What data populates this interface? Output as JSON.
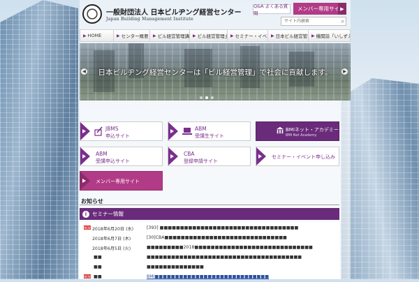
{
  "header": {
    "org_name": "一般財団法人 日本ビルヂング経営センター",
    "org_name_en": "Japan Building Management Institute",
    "qa_label": "Q&A よくある質問",
    "member_site_label": "メンバー専用サイト",
    "search_placeholder": "サイト内検索"
  },
  "nav": {
    "items": [
      {
        "label": "HOME"
      },
      {
        "label": "センター概要"
      },
      {
        "label": "ビル経営管理講座"
      },
      {
        "label": "ビル経営管理士"
      },
      {
        "label": "セミナー・イベント"
      },
      {
        "label": "日本ビル経営管理士会"
      },
      {
        "label": "機関誌「いしずえ」"
      }
    ]
  },
  "hero": {
    "caption": "日本ビルヂング経営センターは「ビル経営管理」で社会に貢献します。"
  },
  "tiles": {
    "jbms": {
      "line1": "JBMS",
      "line2": "申込サイト"
    },
    "abm_student": {
      "line1": "ABM",
      "line2": "受講生サイト"
    },
    "bmi_net": {
      "line1": "BMIネット・アカデミー",
      "line2": "BMI Net Academy"
    },
    "abm_apply": {
      "line1": "ABM",
      "line2": "受講申込サイト"
    },
    "cba": {
      "line1": "CBA",
      "line2": "登録申請サイト"
    },
    "seminar_apply": {
      "label": "セミナー・イベント申し込み"
    },
    "member": {
      "label": "メンバー専用サイト"
    }
  },
  "news": {
    "title": "お知らせ",
    "seminar_header": "セミナー情報",
    "rows": [
      {
        "badge": "NEW",
        "date": "2018年6月20日 (水)",
        "text": "[393] ■■■■■■■■■■■■■■■■■■■■■■■■■■■■■■■■■■",
        "link": false
      },
      {
        "badge": "",
        "date": "2018年6月7日 (木)",
        "text": "[30]CBA■■■■■■■■■■■■■■■■■■■■■■■■■■■■■■",
        "link": false
      },
      {
        "badge": "",
        "date": "2018年6月5日 (火)",
        "text": "■■■■■■■■■2018■■■■■■■■■■■■■■■■■■■■■■■■■■■■■",
        "link": false
      },
      {
        "badge": "",
        "date": "■■",
        "text": "■■■■■■■■■■■■■■■■■■■■■■■■■■■■■■■■■■■■■■",
        "link": false
      },
      {
        "badge": "",
        "date": "■■",
        "text": "■■■■■■■■■■■■■■",
        "link": false
      },
      {
        "badge": "NEW",
        "date": "■■",
        "text": "BMI■■■■■■■■■■■■■■■■■■■■■■■■■■■■",
        "link": true
      }
    ]
  },
  "colors": {
    "accent_purple": "#6a2b7a",
    "accent_magenta": "#b13b86"
  }
}
